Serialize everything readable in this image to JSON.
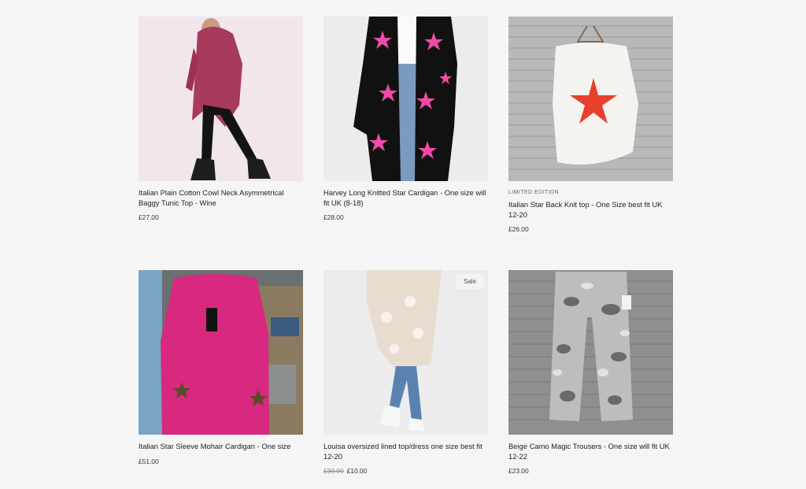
{
  "products": [
    {
      "title": "Italian Plain Cotton Cowl Neck Asymmetrical Baggy Tunic Top - Wine",
      "price": "£27.00",
      "edition": "",
      "badge": "",
      "old_price": ""
    },
    {
      "title": "Harvey Long Knitted Star Cardigan - One size will fit UK (8-18)",
      "price": "£28.00",
      "edition": "",
      "badge": "",
      "old_price": ""
    },
    {
      "title": "Italian Star Back Knit top - One Size best fit UK 12-20",
      "price": "£26.00",
      "edition": "LIMITED EDITION",
      "badge": "",
      "old_price": ""
    },
    {
      "title": "Italian Star Sleeve Mohair Cardigan - One size",
      "price": "£51.00",
      "edition": "",
      "badge": "",
      "old_price": ""
    },
    {
      "title": "Louisa oversized lined top/dress one size best fit 12-20",
      "price": "£10.00",
      "edition": "",
      "badge": "Sale",
      "old_price": "£30.00"
    },
    {
      "title": "Beige Camo Magic Trousers - One size will fit UK 12-22",
      "price": "£23.00",
      "edition": "",
      "badge": "",
      "old_price": ""
    }
  ],
  "colors": {
    "background": "#f5f5f5",
    "star_pink": "#f04ba8",
    "star_red": "#e8402c",
    "wine": "#a83a5c",
    "fuchsia": "#d8287f"
  }
}
